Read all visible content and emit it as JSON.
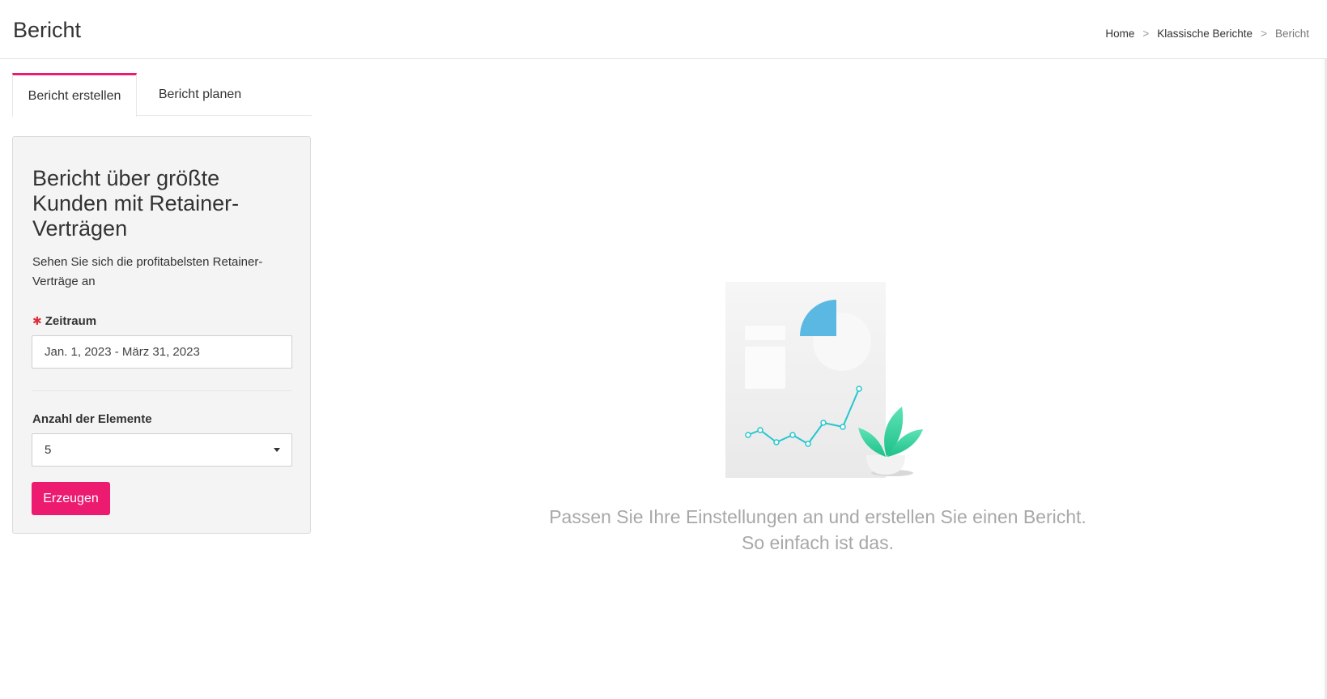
{
  "header": {
    "title": "Bericht",
    "breadcrumb": {
      "home": "Home",
      "separator": ">",
      "section": "Klassische Berichte",
      "current": "Bericht"
    }
  },
  "tabs": [
    {
      "label": "Bericht erstellen",
      "active": true
    },
    {
      "label": "Bericht planen",
      "active": false
    }
  ],
  "panel": {
    "title": "Bericht über größte Kunden mit Retainer-Verträgen",
    "description": "Sehen Sie sich die profitabelsten Retainer-Verträge an",
    "period": {
      "required_marker": "✱",
      "label": "Zeitraum",
      "value": "Jan. 1, 2023 - März 31, 2023"
    },
    "item_count": {
      "label": "Anzahl der Elemente",
      "value": "5"
    },
    "generate_label": "Erzeugen"
  },
  "empty_state": {
    "line1": "Passen Sie Ihre Einstellungen an und erstellen Sie einen Bericht.",
    "line2": "So einfach ist das.",
    "icon": "report-illustration-icon"
  },
  "colors": {
    "accent": "#ec1b70",
    "pie": "#5ab8e3",
    "line": "#24c6d0",
    "plant": "#2ad49a"
  }
}
